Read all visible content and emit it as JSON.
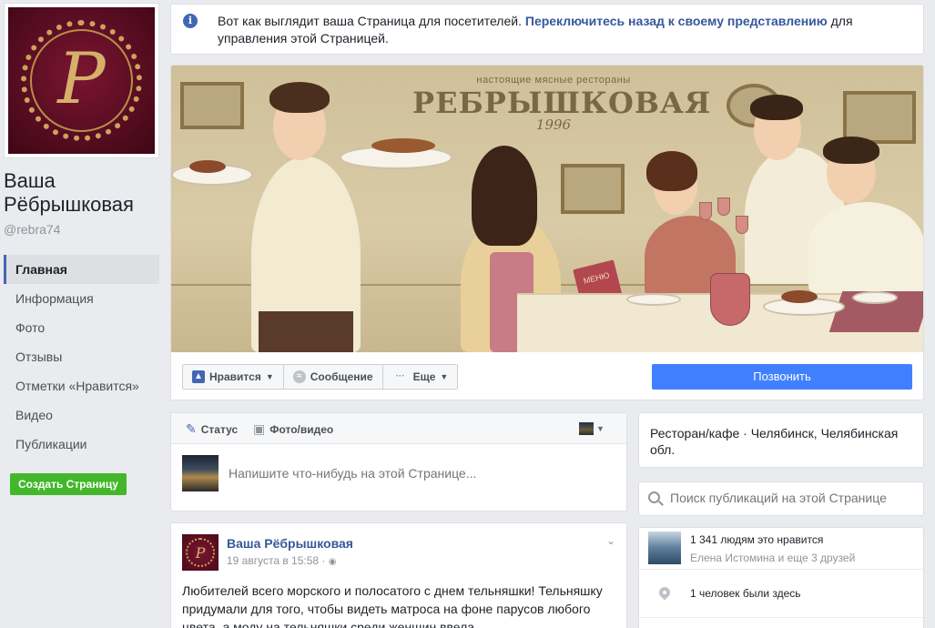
{
  "page": {
    "name": "Ваша Рёбрышковая",
    "handle": "@rebra74",
    "logo_letter": "P"
  },
  "nav": {
    "items": [
      {
        "label": "Главная",
        "active": true
      },
      {
        "label": "Информация"
      },
      {
        "label": "Фото"
      },
      {
        "label": "Отзывы"
      },
      {
        "label": "Отметки «Нравится»"
      },
      {
        "label": "Видео"
      },
      {
        "label": "Публикации"
      }
    ],
    "create_page": "Создать Страницу"
  },
  "notice": {
    "before": "Вот как выглядит ваша Страница для посетителей.",
    "link": "Переключитесь назад к своему представлению",
    "after": "для управления этой Страницей."
  },
  "cover": {
    "brand_sub": "настоящие мясные рестораны",
    "brand": "РЕБРЫШКОВАЯ",
    "brand_year": "1996",
    "menu_label": "МЕНЮ"
  },
  "actions": {
    "like": "Нравится",
    "message": "Сообщение",
    "more": "Еще",
    "call": "Позвонить"
  },
  "composer": {
    "tab_status": "Статус",
    "tab_photo": "Фото/видео",
    "placeholder": "Напишите что-нибудь на этой Странице..."
  },
  "post": {
    "author": "Ваша Рёбрышковая",
    "time": "19 августа в 15:58 · ",
    "text": "Любителей всего морского и полосатого с днем тельняшки! Тельняшку придумали для того, чтобы видеть матроса на фоне парусов любого цвета, а моду на тельняшки среди женщин ввела"
  },
  "sidebar": {
    "category": "Ресторан/кафе · Челябинск, Челябинская обл.",
    "search_placeholder": "Поиск публикаций на этой Странице",
    "likes_main": "1 341 людям это нравится",
    "likes_sub": "Елена Истомина и еще 3 друзей",
    "checkins": "1 человек были здесь"
  },
  "colors": {
    "accent": "#4267b2",
    "call_button": "#4080ff",
    "create_button": "#42b72a",
    "background": "#e9ebee"
  }
}
